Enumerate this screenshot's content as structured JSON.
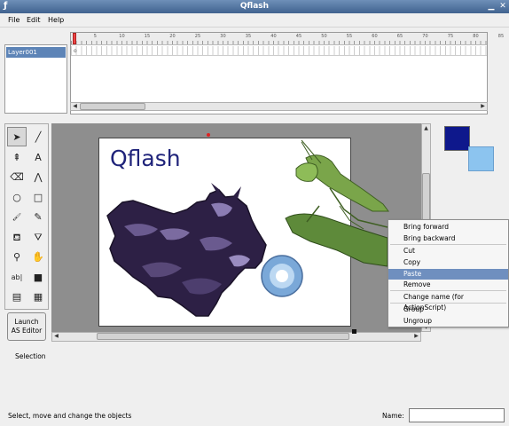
{
  "window": {
    "title": "Qflash",
    "app_icon": "flash-icon",
    "buttons": [
      "minimize-icon",
      "close-icon"
    ]
  },
  "menu": {
    "items": [
      "File",
      "Edit",
      "Help"
    ]
  },
  "layers": {
    "items": [
      {
        "label": "Layer001",
        "selected": true
      }
    ]
  },
  "timeline": {
    "ruler_ticks": [
      "1",
      "5",
      "10",
      "15",
      "20",
      "25",
      "30",
      "35",
      "40",
      "45",
      "50",
      "55",
      "60",
      "65",
      "70",
      "75",
      "80",
      "85"
    ],
    "keyframe_marker": "o"
  },
  "tools": [
    {
      "name": "selection",
      "icon": "arrow-pointer-icon",
      "glyph": "➤"
    },
    {
      "name": "line",
      "icon": "line-icon",
      "glyph": "╱"
    },
    {
      "name": "subselection",
      "icon": "subselect-icon",
      "glyph": "⇞"
    },
    {
      "name": "text",
      "icon": "text-icon",
      "glyph": "A"
    },
    {
      "name": "eraser",
      "icon": "eraser-icon",
      "glyph": "⌫"
    },
    {
      "name": "polyline",
      "icon": "polyline-icon",
      "glyph": "⋀"
    },
    {
      "name": "oval",
      "icon": "circle-icon",
      "glyph": "○"
    },
    {
      "name": "rectangle",
      "icon": "square-icon",
      "glyph": "□"
    },
    {
      "name": "brush",
      "icon": "brush-icon",
      "glyph": "🖌"
    },
    {
      "name": "pencil",
      "icon": "pencil-icon",
      "glyph": "✎"
    },
    {
      "name": "paint-bucket",
      "icon": "paint-bucket-icon",
      "glyph": "⛾"
    },
    {
      "name": "ink-bottle",
      "icon": "ink-bottle-icon",
      "glyph": "⛛"
    },
    {
      "name": "zoom",
      "icon": "magnifier-icon",
      "glyph": "⚲"
    },
    {
      "name": "hand",
      "icon": "hand-icon",
      "glyph": "✋"
    },
    {
      "name": "text-field",
      "icon": "text-field-icon",
      "glyph": "ab|"
    },
    {
      "name": "fill-square",
      "icon": "fill-square-icon",
      "glyph": "■"
    },
    {
      "name": "actionscript",
      "icon": "script-icon",
      "glyph": "▤"
    },
    {
      "name": "library",
      "icon": "library-icon",
      "glyph": "▦"
    }
  ],
  "launch_button": {
    "line1": "Launch",
    "line2": "AS Editor"
  },
  "active_tool_label": "Selection",
  "stage": {
    "logo_text": "Qflash"
  },
  "colors": {
    "stroke": "#0e188c",
    "fill": "#8cc4ef",
    "accent": "#6f8fbf"
  },
  "context_menu": {
    "items": [
      {
        "label": "Bring forward",
        "highlighted": false
      },
      {
        "label": "Bring backward",
        "highlighted": false
      },
      {
        "label": "Cut",
        "highlighted": false
      },
      {
        "label": "Copy",
        "highlighted": false
      },
      {
        "label": "Paste",
        "highlighted": true
      },
      {
        "label": "Remove",
        "highlighted": false
      },
      {
        "label": "Change name (for ActionScript)",
        "highlighted": false
      },
      {
        "label": "Group",
        "highlighted": false
      },
      {
        "label": "Ungroup",
        "highlighted": false
      }
    ]
  },
  "status": {
    "text": "Select, move and change the objects"
  },
  "name_field": {
    "label": "Name:",
    "value": ""
  }
}
